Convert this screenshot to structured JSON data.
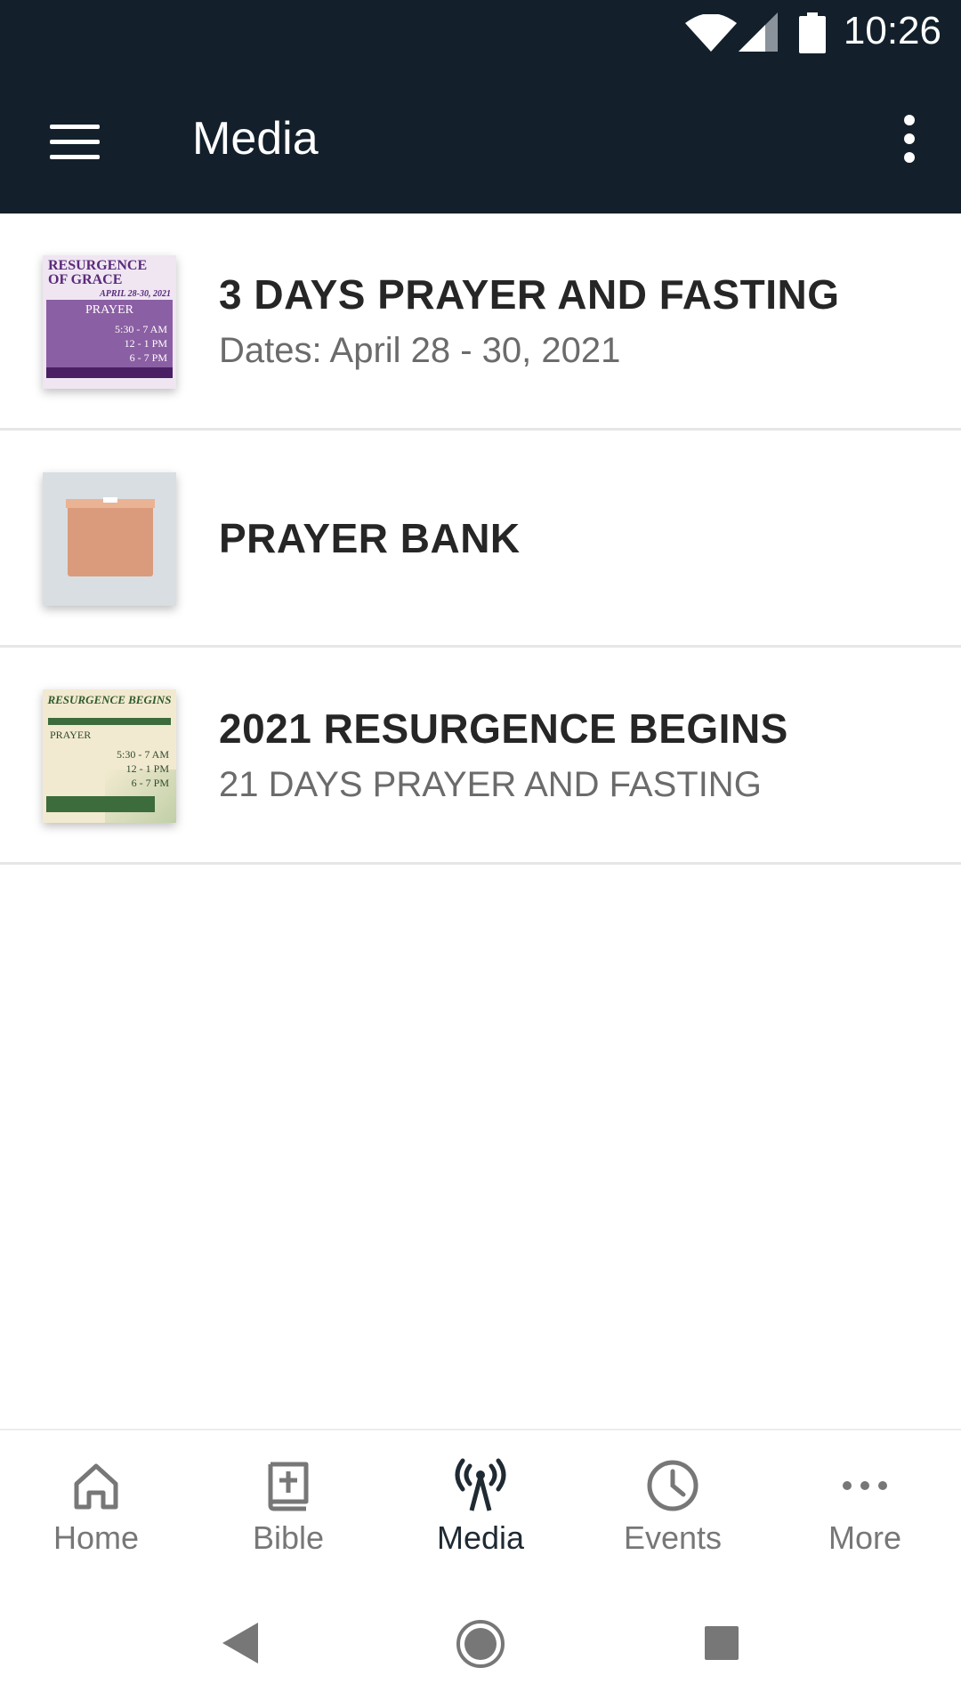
{
  "status_bar": {
    "time": "10:26"
  },
  "app_bar": {
    "title": "Media"
  },
  "items": [
    {
      "title": "3 DAYS PRAYER AND FASTING",
      "subtitle": "Dates: April 28 - 30, 2021",
      "thumb": {
        "line1": "RESURGENCE",
        "line2": "OF GRACE",
        "line3": "APRIL 28-30, 2021",
        "label": "PRAYER",
        "times": [
          "5:30 - 7 AM",
          "12 - 1 PM",
          "6 - 7 PM"
        ]
      }
    },
    {
      "title": "PRAYER BANK",
      "subtitle": ""
    },
    {
      "title": "2021 RESURGENCE BEGINS",
      "subtitle": "21 DAYS PRAYER AND FASTING",
      "thumb": {
        "line1": "RESURGENCE BEGINS",
        "label": "PRAYER",
        "times": [
          "5:30 - 7 AM",
          "12 - 1 PM",
          "6 - 7 PM"
        ]
      }
    }
  ],
  "bottom_nav": [
    {
      "label": "Home",
      "icon": "home-icon"
    },
    {
      "label": "Bible",
      "icon": "bible-icon"
    },
    {
      "label": "Media",
      "icon": "broadcast-icon",
      "active": true
    },
    {
      "label": "Events",
      "icon": "clock-icon"
    },
    {
      "label": "More",
      "icon": "more-horizontal-icon"
    }
  ],
  "colors": {
    "app_bar": "#13202b",
    "active_tab": "#1f2a33",
    "inactive_tab": "#777777"
  }
}
